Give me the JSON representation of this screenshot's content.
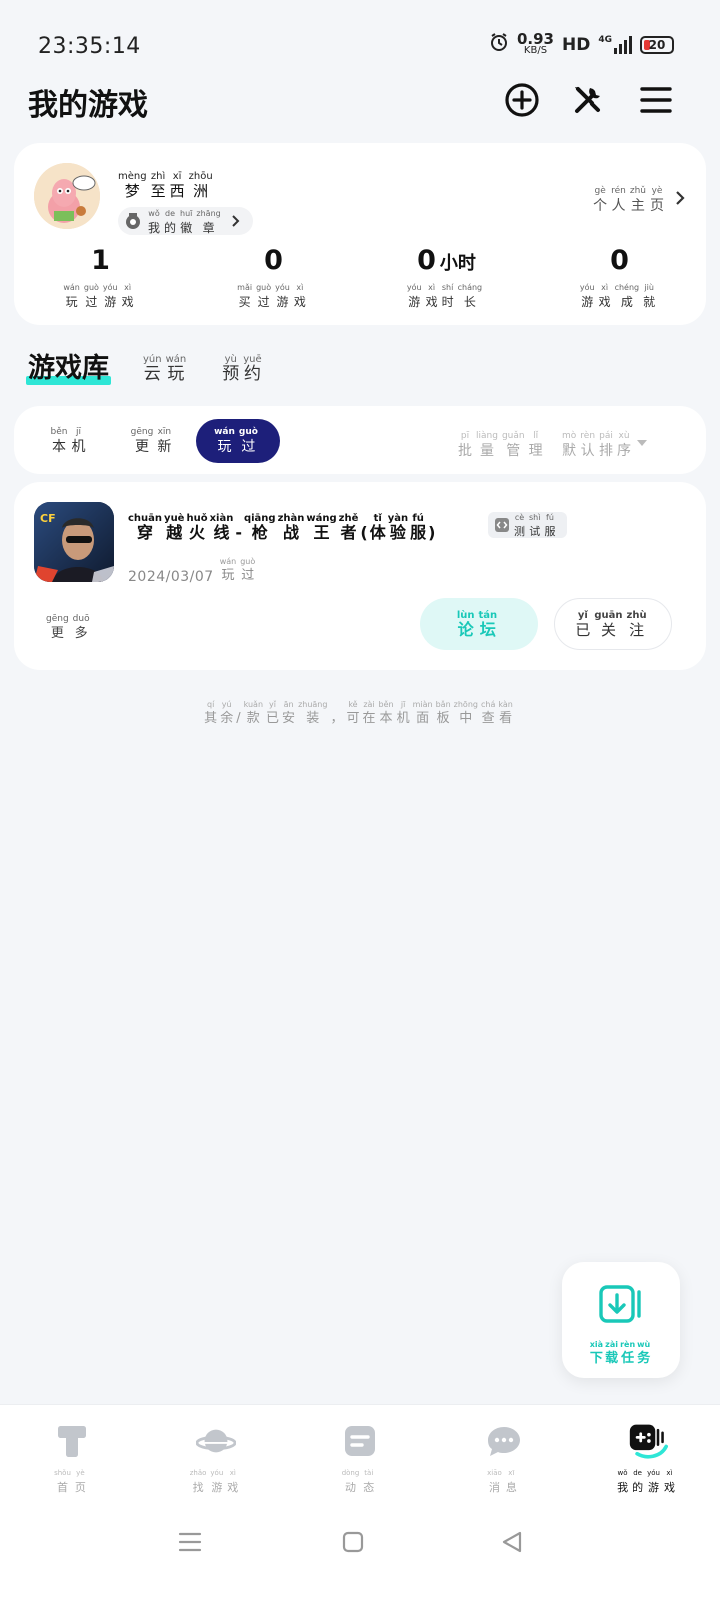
{
  "status": {
    "time": "23:35:14",
    "speed": "0.93",
    "speed_unit": "KB/S",
    "hd": "HD",
    "net": "4G",
    "battery": "20"
  },
  "header": {
    "title": "我的游戏",
    "icons": [
      "add-circle-icon",
      "tools-icon",
      "menu-icon"
    ]
  },
  "profile": {
    "name": [
      [
        "梦",
        "mèng"
      ],
      [
        "至",
        "zhì"
      ],
      [
        "西",
        "xī"
      ],
      [
        "洲",
        "zhōu"
      ]
    ],
    "badge": [
      [
        "我",
        "wǒ"
      ],
      [
        "的",
        "de"
      ],
      [
        "徽",
        "huī"
      ],
      [
        "章",
        "zhāng"
      ]
    ],
    "home_link": [
      [
        "个",
        "gè"
      ],
      [
        "人",
        "rén"
      ],
      [
        "主",
        "zhǔ"
      ],
      [
        "页",
        "yè"
      ]
    ],
    "stats": [
      {
        "value": "1",
        "unit": "",
        "label": [
          [
            "玩",
            "wán"
          ],
          [
            "过",
            "guò"
          ],
          [
            "游",
            "yóu"
          ],
          [
            "戏",
            "xì"
          ]
        ]
      },
      {
        "value": "0",
        "unit": "",
        "label": [
          [
            "买",
            "mǎi"
          ],
          [
            "过",
            "guò"
          ],
          [
            "游",
            "yóu"
          ],
          [
            "戏",
            "xì"
          ]
        ]
      },
      {
        "value": "0",
        "unit": "小时",
        "label": [
          [
            "游",
            "yóu"
          ],
          [
            "戏",
            "xì"
          ],
          [
            "时",
            "shí"
          ],
          [
            "长",
            "cháng"
          ]
        ]
      },
      {
        "value": "0",
        "unit": "",
        "label": [
          [
            "游",
            "yóu"
          ],
          [
            "戏",
            "xì"
          ],
          [
            "成",
            "chéng"
          ],
          [
            "就",
            "jiù"
          ]
        ]
      }
    ]
  },
  "library": {
    "title": "游戏库",
    "tabs": [
      [
        [
          "云",
          "yún"
        ],
        [
          "玩",
          "wán"
        ]
      ],
      [
        [
          "预",
          "yù"
        ],
        [
          "约",
          "yuē"
        ]
      ]
    ]
  },
  "filters": {
    "tabs": [
      [
        [
          "本",
          "běn"
        ],
        [
          "机",
          "jī"
        ]
      ],
      [
        [
          "更",
          "gēng"
        ],
        [
          "新",
          "xīn"
        ]
      ],
      [
        [
          "玩",
          "wán"
        ],
        [
          "过",
          "guò"
        ]
      ]
    ],
    "active_index": 2,
    "batch": [
      [
        "批",
        "pī"
      ],
      [
        "量",
        "liàng"
      ],
      [
        "管",
        "guǎn"
      ],
      [
        "理",
        "lǐ"
      ]
    ],
    "sort": [
      [
        "默",
        "mò"
      ],
      [
        "认",
        "rèn"
      ],
      [
        "排",
        "pái"
      ],
      [
        "序",
        "xù"
      ]
    ]
  },
  "game": {
    "title": [
      [
        "穿",
        "chuān"
      ],
      [
        "越",
        "yuè"
      ],
      [
        "火",
        "huǒ"
      ],
      [
        "线",
        "xiàn"
      ],
      [
        "-",
        ""
      ],
      [
        "枪",
        "qiāng"
      ],
      [
        "战",
        "zhàn"
      ],
      [
        "王",
        "wáng"
      ],
      [
        "者",
        "zhě"
      ],
      [
        "(",
        ""
      ],
      [
        "体",
        "tǐ"
      ],
      [
        "验",
        "yàn"
      ],
      [
        "服",
        "fú"
      ],
      [
        ")",
        ""
      ]
    ],
    "tag": [
      [
        "测",
        "cè"
      ],
      [
        "试",
        "shì"
      ],
      [
        "服",
        "fú"
      ]
    ],
    "date": "2024/03/07",
    "played": [
      [
        "玩",
        "wán"
      ],
      [
        "过",
        "guò"
      ]
    ],
    "more": [
      [
        "更",
        "gēng"
      ],
      [
        "多",
        "duō"
      ]
    ],
    "forum": [
      [
        "论",
        "lùn"
      ],
      [
        "坛",
        "tán"
      ]
    ],
    "follow": [
      [
        "已",
        "yǐ"
      ],
      [
        "关",
        "guān"
      ],
      [
        "注",
        "zhù"
      ]
    ]
  },
  "hint": [
    [
      "其",
      "qí"
    ],
    [
      "余",
      "yú"
    ],
    [
      "/",
      ""
    ],
    [
      "款",
      "kuǎn"
    ],
    [
      "已",
      "yǐ"
    ],
    [
      "安",
      "ān"
    ],
    [
      "装",
      "zhuāng"
    ],
    [
      "，",
      ""
    ],
    [
      "可",
      "kě"
    ],
    [
      "在",
      "zài"
    ],
    [
      "本",
      "běn"
    ],
    [
      "机",
      "jī"
    ],
    [
      "面",
      "miàn"
    ],
    [
      "板",
      "bǎn"
    ],
    [
      "中",
      "zhōng"
    ],
    [
      "查",
      "chá"
    ],
    [
      "看",
      "kàn"
    ]
  ],
  "fab": {
    "label": [
      [
        "下",
        "xià"
      ],
      [
        "载",
        "zài"
      ],
      [
        "任",
        "rèn"
      ],
      [
        "务",
        "wù"
      ]
    ],
    "icon": "download-icon"
  },
  "tabbar": [
    {
      "icon": "home-icon",
      "label": [
        [
          "首",
          "shǒu"
        ],
        [
          "页",
          "yè"
        ]
      ]
    },
    {
      "icon": "planet-icon",
      "label": [
        [
          "找",
          "zhǎo"
        ],
        [
          "游",
          "yóu"
        ],
        [
          "戏",
          "xì"
        ]
      ]
    },
    {
      "icon": "feed-icon",
      "label": [
        [
          "动",
          "dòng"
        ],
        [
          "态",
          "tài"
        ]
      ]
    },
    {
      "icon": "message-icon",
      "label": [
        [
          "消",
          "xiāo"
        ],
        [
          "息",
          "xī"
        ]
      ]
    },
    {
      "icon": "gamepad-icon",
      "label": [
        [
          "我",
          "wǒ"
        ],
        [
          "的",
          "de"
        ],
        [
          "游",
          "yóu"
        ],
        [
          "戏",
          "xì"
        ]
      ]
    }
  ],
  "tabbar_active_index": 4,
  "colors": {
    "accent": "#19c8b8",
    "active_filter": "#1d1f7a",
    "highlight": "#2ee6d6"
  }
}
